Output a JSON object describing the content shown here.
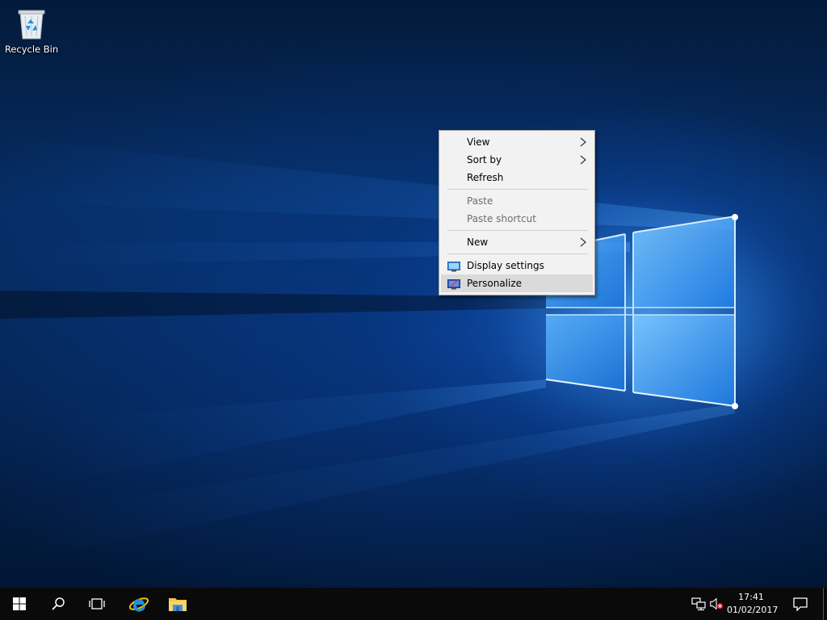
{
  "desktop": {
    "icons": [
      {
        "label": "Recycle Bin",
        "icon": "recycle-bin-icon"
      }
    ]
  },
  "context_menu": {
    "items": [
      {
        "label": "View",
        "submenu": true,
        "disabled": false
      },
      {
        "label": "Sort by",
        "submenu": true,
        "disabled": false
      },
      {
        "label": "Refresh",
        "submenu": false,
        "disabled": false
      },
      {
        "separator": true
      },
      {
        "label": "Paste",
        "submenu": false,
        "disabled": true
      },
      {
        "label": "Paste shortcut",
        "submenu": false,
        "disabled": true
      },
      {
        "separator": true
      },
      {
        "label": "New",
        "submenu": true,
        "disabled": false
      },
      {
        "separator": true
      },
      {
        "label": "Display settings",
        "icon": "display-settings-icon",
        "disabled": false
      },
      {
        "label": "Personalize",
        "icon": "personalize-icon",
        "disabled": false,
        "highlighted": true
      }
    ]
  },
  "taskbar": {
    "buttons": [
      {
        "name": "start",
        "icon": "windows-logo-icon"
      },
      {
        "name": "search",
        "icon": "search-icon"
      },
      {
        "name": "task-view",
        "icon": "task-view-icon"
      },
      {
        "name": "internet-explorer",
        "icon": "internet-explorer-icon"
      },
      {
        "name": "file-explorer",
        "icon": "file-explorer-icon"
      }
    ],
    "tray": {
      "icons": [
        "network-icon",
        "volume-muted-icon"
      ],
      "clock": {
        "time": "17:41",
        "date": "01/02/2017"
      },
      "notification_icon": "action-center-icon"
    }
  },
  "colors": {
    "taskbar_bg": "#0a0a0a",
    "menu_bg": "#f2f2f2",
    "menu_highlight": "#dadada",
    "menu_disabled_text": "#6d6d6d",
    "wallpaper_glow": "#4aa8ff"
  }
}
